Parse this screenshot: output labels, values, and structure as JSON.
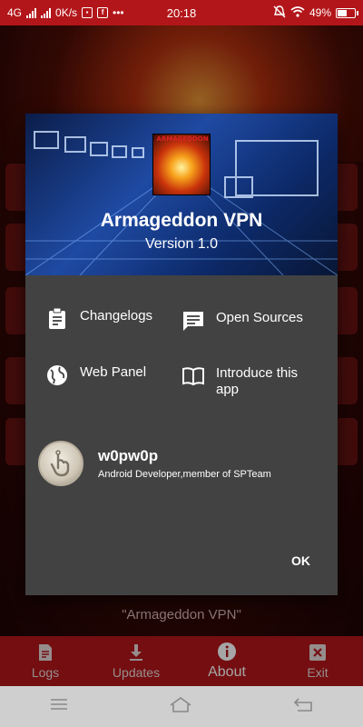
{
  "status_bar": {
    "network": "4G",
    "speed": "0K/s",
    "time": "20:18",
    "battery": "49%",
    "notif_icons": [
      "gallery-icon",
      "facebook-icon"
    ],
    "dots": "•••"
  },
  "background": {
    "footer_text": "\"Armageddon VPN\""
  },
  "dialog": {
    "logo_text": "ARMAGEDDON",
    "app_name": "Armageddon VPN",
    "version": "Version 1.0",
    "items": [
      {
        "label": "Changelogs",
        "icon": "clipboard-icon"
      },
      {
        "label": "Open Sources",
        "icon": "chat-icon"
      },
      {
        "label": "Web Panel",
        "icon": "globe-icon"
      },
      {
        "label": "Introduce this app",
        "icon": "book-icon"
      }
    ],
    "author": {
      "name": "w0pw0p",
      "description": "Android Developer,member of SPTeam"
    },
    "ok_label": "OK"
  },
  "bottom_nav": [
    {
      "label": "Logs",
      "icon": "document-icon"
    },
    {
      "label": "Updates",
      "icon": "download-icon"
    },
    {
      "label": "About",
      "icon": "info-icon",
      "active": true
    },
    {
      "label": "Exit",
      "icon": "close-box-icon"
    }
  ],
  "colors": {
    "accent": "#b3161a",
    "dialog_bg": "#424242",
    "hero_blue": "#1f4aa3"
  }
}
